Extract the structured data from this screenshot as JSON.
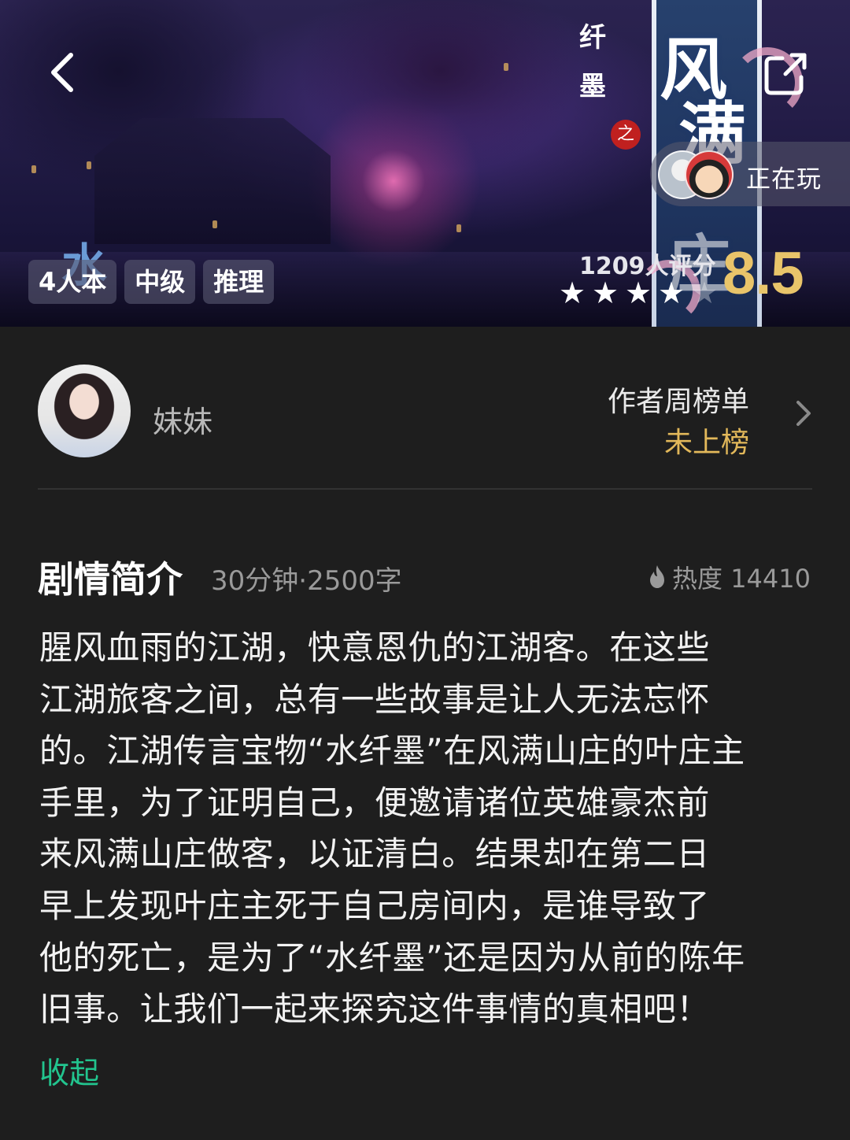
{
  "hero": {
    "tags": [
      "4人本",
      "中级",
      "推理"
    ],
    "playing_label": "正在玩",
    "rating_count": "1209人评分",
    "score": "8.5",
    "stars": {
      "filled": 4,
      "total": 5
    },
    "poster_title_vertical": [
      "风",
      "满",
      "庄"
    ],
    "poster_small_chars": [
      "纤",
      "墨"
    ],
    "poster_seal": "之",
    "poster_side_char": "水"
  },
  "author": {
    "name": "妹妹",
    "weekly_rank_title": "作者周榜单",
    "weekly_rank_status": "未上榜"
  },
  "synopsis": {
    "title": "剧情简介",
    "meta": "30分钟·2500字",
    "heat": "热度 14410",
    "body": "腥风血雨的江湖，快意恩仇的江湖客。在这些\n江湖旅客之间，总有一些故事是让人无法忘怀\n的。江湖传言宝物“水纤墨”在风满山庄的叶庄主\n手里，为了证明自己，便邀请诸位英雄豪杰前\n来风满山庄做客，以证清白。结果却在第二日\n早上发现叶庄主死于自己房间内，是谁导致了\n他的死亡，是为了“水纤墨”还是因为从前的陈年\n旧事。让我们一起来探究这件事情的真相吧！",
    "collapse_label": "收起"
  },
  "colors": {
    "background": "#1e1e1e",
    "score": "#e9c46a",
    "rank_status": "#e2b85a",
    "collapse_link": "#22c48e"
  },
  "icons": {
    "back": "back-arrow-icon",
    "share": "share-icon",
    "heat": "flame-icon",
    "chevron": "chevron-right-icon",
    "star": "star-icon"
  }
}
